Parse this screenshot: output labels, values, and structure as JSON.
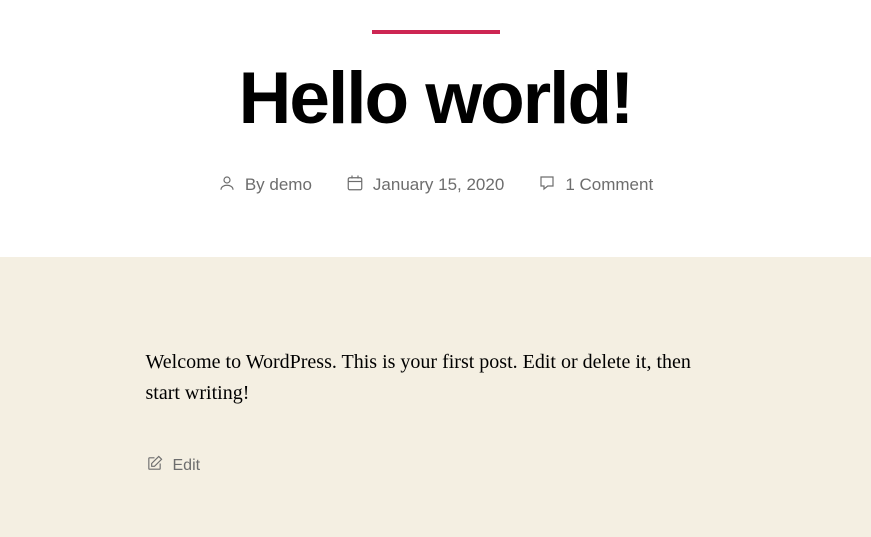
{
  "post": {
    "title": "Hello world!",
    "meta": {
      "by_label": "By",
      "author": "demo",
      "date": "January 15, 2020",
      "comments": "1 Comment"
    },
    "content": "Welcome to WordPress. This is your first post. Edit or delete it, then start writing!",
    "edit_label": "Edit"
  }
}
